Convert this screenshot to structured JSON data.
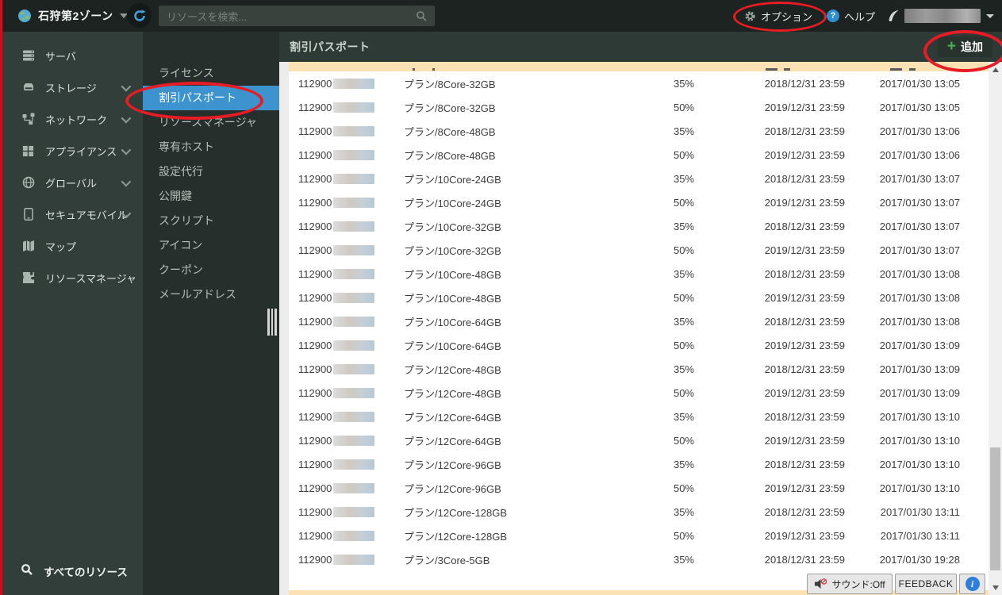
{
  "topbar": {
    "zone": "石狩第2ゾーン",
    "search_placeholder": "リソースを検索...",
    "options_label": "オプション",
    "help_label": "ヘルプ"
  },
  "sidebar": {
    "items": [
      {
        "label": "サーバ",
        "icon": "server-icon",
        "chevron": false
      },
      {
        "label": "ストレージ",
        "icon": "storage-icon",
        "chevron": true
      },
      {
        "label": "ネットワーク",
        "icon": "network-icon",
        "chevron": true
      },
      {
        "label": "アプライアンス",
        "icon": "appliance-icon",
        "chevron": true
      },
      {
        "label": "グローバル",
        "icon": "globe-icon",
        "chevron": true
      },
      {
        "label": "セキュアモバイル",
        "icon": "mobile-icon",
        "chevron": true
      },
      {
        "label": "マップ",
        "icon": "map-icon",
        "chevron": false
      },
      {
        "label": "リソースマネージャ",
        "icon": "puzzle-icon",
        "chevron": false
      }
    ],
    "footer_item": {
      "label": "すべてのリソース",
      "icon": "search-icon"
    }
  },
  "subsidebar": {
    "items": [
      {
        "label": "ライセンス",
        "selected": false
      },
      {
        "label": "割引パスポート",
        "selected": true
      },
      {
        "label": "リソースマネージャ",
        "selected": false
      },
      {
        "label": "専有ホスト",
        "selected": false
      },
      {
        "label": "設定代行",
        "selected": false
      },
      {
        "label": "公開鍵",
        "selected": false
      },
      {
        "label": "スクリプト",
        "selected": false
      },
      {
        "label": "アイコン",
        "selected": false
      },
      {
        "label": "クーポン",
        "selected": false
      },
      {
        "label": "メールアドレス",
        "selected": false
      }
    ]
  },
  "content": {
    "title": "割引パスポート",
    "add_button_label": "追加"
  },
  "table": {
    "rows": [
      {
        "id": "112900",
        "plan": "プラン/8Core-32GB",
        "discount": "35%",
        "expires": "2018/12/31 23:59",
        "created": "2017/01/30 13:05"
      },
      {
        "id": "112900",
        "plan": "プラン/8Core-32GB",
        "discount": "50%",
        "expires": "2019/12/31 23:59",
        "created": "2017/01/30 13:05"
      },
      {
        "id": "112900",
        "plan": "プラン/8Core-48GB",
        "discount": "35%",
        "expires": "2018/12/31 23:59",
        "created": "2017/01/30 13:06"
      },
      {
        "id": "112900",
        "plan": "プラン/8Core-48GB",
        "discount": "50%",
        "expires": "2019/12/31 23:59",
        "created": "2017/01/30 13:06"
      },
      {
        "id": "112900",
        "plan": "プラン/10Core-24GB",
        "discount": "35%",
        "expires": "2018/12/31 23:59",
        "created": "2017/01/30 13:07"
      },
      {
        "id": "112900",
        "plan": "プラン/10Core-24GB",
        "discount": "50%",
        "expires": "2019/12/31 23:59",
        "created": "2017/01/30 13:07"
      },
      {
        "id": "112900",
        "plan": "プラン/10Core-32GB",
        "discount": "35%",
        "expires": "2018/12/31 23:59",
        "created": "2017/01/30 13:07"
      },
      {
        "id": "112900",
        "plan": "プラン/10Core-32GB",
        "discount": "50%",
        "expires": "2019/12/31 23:59",
        "created": "2017/01/30 13:07"
      },
      {
        "id": "112900",
        "plan": "プラン/10Core-48GB",
        "discount": "35%",
        "expires": "2018/12/31 23:59",
        "created": "2017/01/30 13:08"
      },
      {
        "id": "112900",
        "plan": "プラン/10Core-48GB",
        "discount": "50%",
        "expires": "2019/12/31 23:59",
        "created": "2017/01/30 13:08"
      },
      {
        "id": "112900",
        "plan": "プラン/10Core-64GB",
        "discount": "35%",
        "expires": "2018/12/31 23:59",
        "created": "2017/01/30 13:08"
      },
      {
        "id": "112900",
        "plan": "プラン/10Core-64GB",
        "discount": "50%",
        "expires": "2019/12/31 23:59",
        "created": "2017/01/30 13:09"
      },
      {
        "id": "112900",
        "plan": "プラン/12Core-48GB",
        "discount": "35%",
        "expires": "2018/12/31 23:59",
        "created": "2017/01/30 13:09"
      },
      {
        "id": "112900",
        "plan": "プラン/12Core-48GB",
        "discount": "50%",
        "expires": "2019/12/31 23:59",
        "created": "2017/01/30 13:09"
      },
      {
        "id": "112900",
        "plan": "プラン/12Core-64GB",
        "discount": "35%",
        "expires": "2018/12/31 23:59",
        "created": "2017/01/30 13:10"
      },
      {
        "id": "112900",
        "plan": "プラン/12Core-64GB",
        "discount": "50%",
        "expires": "2019/12/31 23:59",
        "created": "2017/01/30 13:10"
      },
      {
        "id": "112900",
        "plan": "プラン/12Core-96GB",
        "discount": "35%",
        "expires": "2018/12/31 23:59",
        "created": "2017/01/30 13:10"
      },
      {
        "id": "112900",
        "plan": "プラン/12Core-96GB",
        "discount": "50%",
        "expires": "2019/12/31 23:59",
        "created": "2017/01/30 13:10"
      },
      {
        "id": "112900",
        "plan": "プラン/12Core-128GB",
        "discount": "35%",
        "expires": "2018/12/31 23:59",
        "created": "2017/01/30 13:11"
      },
      {
        "id": "112900",
        "plan": "プラン/12Core-128GB",
        "discount": "50%",
        "expires": "2019/12/31 23:59",
        "created": "2017/01/30 13:11"
      },
      {
        "id": "112900",
        "plan": "プラン/3Core-5GB",
        "discount": "35%",
        "expires": "2018/12/31 23:59",
        "created": "2017/01/30 19:28"
      }
    ]
  },
  "footer": {
    "sound_label": "サウンド:Off",
    "feedback_label": "FEEDBACK"
  },
  "colors": {
    "selected_blue": "#3d93ce",
    "annotation_red": "#e81c24",
    "cream_strip": "#fbe2b4",
    "add_green": "#4bb254",
    "topbar_bg": "#1c2320",
    "sidebar_bg": "#323e39",
    "subsidebar_bg": "#262f2b"
  }
}
